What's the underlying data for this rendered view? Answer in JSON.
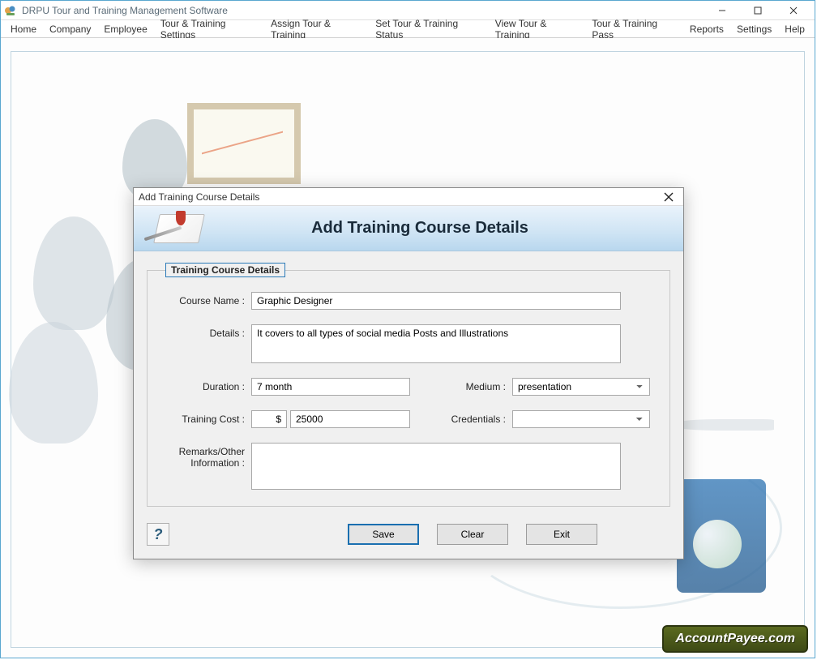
{
  "app": {
    "title": "DRPU Tour and Training Management Software"
  },
  "menu": {
    "items": [
      "Home",
      "Company",
      "Employee",
      "Tour & Training Settings",
      "Assign Tour & Training",
      "Set Tour & Training Status",
      "View Tour & Training",
      "Tour & Training Pass",
      "Reports",
      "Settings",
      "Help"
    ]
  },
  "dialog": {
    "title": "Add Training Course Details",
    "heading": "Add Training Course Details",
    "group_legend": "Training Course Details",
    "labels": {
      "course_name": "Course Name :",
      "details": "Details :",
      "duration": "Duration :",
      "medium": "Medium :",
      "training_cost": "Training Cost :",
      "credentials": "Credentials :",
      "remarks_line1": "Remarks/Other",
      "remarks_line2": "Information :"
    },
    "fields": {
      "course_name": "Graphic Designer",
      "details": "It covers to all types of social media Posts and Illustrations",
      "duration": "7 month",
      "medium": "presentation",
      "currency": "$",
      "cost": "25000",
      "credentials": "",
      "remarks": ""
    },
    "buttons": {
      "save": "Save",
      "clear": "Clear",
      "exit": "Exit"
    }
  },
  "watermark": "AccountPayee.com"
}
